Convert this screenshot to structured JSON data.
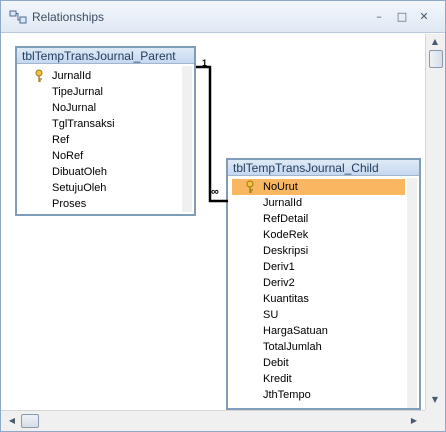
{
  "window": {
    "title": "Relationships",
    "controls": {
      "minimize": "–",
      "maximize": "□",
      "close": "✕"
    }
  },
  "tables": [
    {
      "name": "tblTempTransJournal_Parent",
      "fields": [
        {
          "name": "JurnalId",
          "primary_key": true
        },
        {
          "name": "TipeJurnal"
        },
        {
          "name": "NoJurnal"
        },
        {
          "name": "TglTransaksi"
        },
        {
          "name": "Ref"
        },
        {
          "name": "NoRef"
        },
        {
          "name": "DibuatOleh"
        },
        {
          "name": "SetujuOleh"
        },
        {
          "name": "Proses"
        }
      ]
    },
    {
      "name": "tblTempTransJournal_Child",
      "selected_field": "NoUrut",
      "fields": [
        {
          "name": "NoUrut",
          "primary_key": true
        },
        {
          "name": "JurnalId"
        },
        {
          "name": "RefDetail"
        },
        {
          "name": "KodeRek"
        },
        {
          "name": "Deskripsi"
        },
        {
          "name": "Deriv1"
        },
        {
          "name": "Deriv2"
        },
        {
          "name": "Kuantitas"
        },
        {
          "name": "SU"
        },
        {
          "name": "HargaSatuan"
        },
        {
          "name": "TotalJumlah"
        },
        {
          "name": "Debit"
        },
        {
          "name": "Kredit"
        },
        {
          "name": "JthTempo"
        }
      ]
    }
  ],
  "relationship": {
    "from": "JurnalId",
    "to": "JurnalId",
    "one_label": "1",
    "many_label": "∞"
  },
  "colors": {
    "selection": "#f8b760",
    "table_border": "#7f9db9",
    "header_text": "#1f3a5b"
  }
}
